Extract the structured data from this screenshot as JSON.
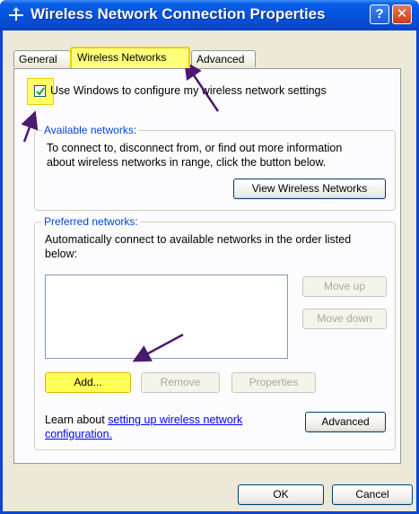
{
  "window": {
    "title": "Wireless Network Connection Properties"
  },
  "titlebar": {
    "help_glyph": "?",
    "close_glyph": "✕"
  },
  "tabs": [
    {
      "label": "General"
    },
    {
      "label": "Wireless Networks"
    },
    {
      "label": "Advanced"
    }
  ],
  "checkbox": {
    "label": "Use Windows to configure my wireless network settings",
    "checked": true
  },
  "available": {
    "legend": "Available networks:",
    "description_line1": "To connect to, disconnect from, or find out more information",
    "description_line2": "about wireless networks in range, click the button below.",
    "view_button": "View Wireless Networks"
  },
  "preferred": {
    "legend": "Preferred networks:",
    "description_line1": "Automatically connect to available networks in the order listed",
    "description_line2": "below:",
    "move_up": "Move up",
    "move_down": "Move down",
    "add": "Add...",
    "remove": "Remove",
    "properties": "Properties"
  },
  "learn": {
    "prefix": "Learn about ",
    "link_line1": "setting up wireless network",
    "link_line2": "configuration.",
    "advanced_button": "Advanced"
  },
  "footer": {
    "ok": "OK",
    "cancel": "Cancel"
  },
  "colors": {
    "titlebar": "#0553de",
    "highlight": "#ffff66",
    "arrow": "#4b1a6e",
    "group_legend": "#0046d5"
  }
}
